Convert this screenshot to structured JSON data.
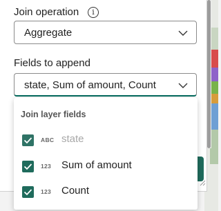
{
  "join_operation": {
    "label": "Join operation",
    "info_icon": "info-icon",
    "selected": "Aggregate"
  },
  "fields_to_append": {
    "label": "Fields to append",
    "selected": "state, Sum of amount, Count"
  },
  "dropdown": {
    "header": "Join layer fields",
    "items": [
      {
        "type": "ABC",
        "name": "state",
        "checked": true,
        "disabled": true
      },
      {
        "type": "123",
        "name": "Sum of amount",
        "checked": true,
        "disabled": false
      },
      {
        "type": "123",
        "name": "Count",
        "checked": true,
        "disabled": false
      }
    ]
  },
  "colors": {
    "accent": "#1f6b5c",
    "text": "#1f1f1f",
    "disabled_text": "#a8a8a8"
  }
}
